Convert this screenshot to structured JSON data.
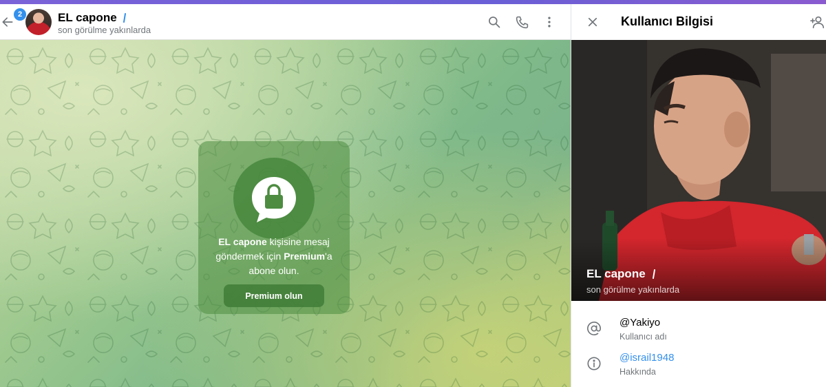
{
  "chat": {
    "unread_count": "2",
    "contact_name": "EL capone",
    "status": "son görülme yakınlarda",
    "restriction": {
      "name": "EL capone",
      "part1": " kişisine mesaj göndermek için ",
      "premium_word": "Premium",
      "part2": "'a abone olun.",
      "button_label": "Premium olun"
    }
  },
  "info": {
    "title": "Kullanıcı Bilgisi",
    "profile_name": "EL capone",
    "profile_status": "son görülme yakınlarda",
    "username": "@Yakiyo",
    "username_label": "Kullanıcı adı",
    "bio": "@israil1948",
    "bio_label": "Hakkında"
  },
  "icons": {
    "back": "arrow-left-icon",
    "search": "search-icon",
    "call": "phone-icon",
    "more": "more-vertical-icon",
    "close": "close-icon",
    "add_contact": "add-user-icon",
    "username": "at-sign-icon",
    "bio": "info-icon",
    "lock": "lock-bubble-icon"
  },
  "colors": {
    "accent": "#3390ec",
    "muted": "#707579",
    "card": "#4c8c40"
  }
}
